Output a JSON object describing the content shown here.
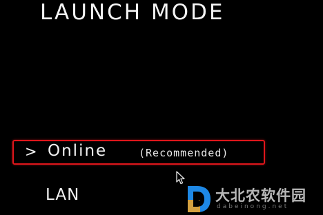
{
  "screen": {
    "title": "LAUNCH MODE"
  },
  "options": [
    {
      "label": "Online",
      "note": "(Recommended)",
      "selected": true,
      "prefix": ">"
    },
    {
      "label": "LAN",
      "selected": false
    }
  ],
  "colors": {
    "background": "#000000",
    "text": "#f2f2f2",
    "selection_border": "#e0161b"
  },
  "watermark": {
    "name": "大北农软件园",
    "domain": "dabeinong.net"
  }
}
